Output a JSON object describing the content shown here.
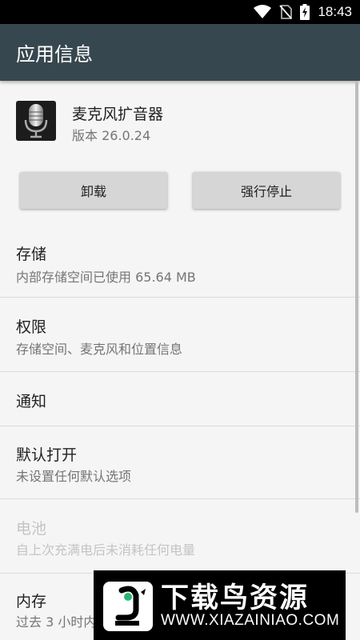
{
  "status_bar": {
    "time": "18:43",
    "icons": [
      "wifi-icon",
      "no-sim-icon",
      "battery-charging-icon"
    ]
  },
  "app_bar": {
    "title": "应用信息"
  },
  "app": {
    "name": "麦克风扩音器",
    "version": "版本 26.0.24",
    "icon": "microphone-icon"
  },
  "buttons": {
    "uninstall": "卸载",
    "force_stop": "强行停止"
  },
  "settings": [
    {
      "title": "存储",
      "subtitle": "内部存储空间已使用 65.64 MB",
      "enabled": true
    },
    {
      "title": "权限",
      "subtitle": "存储空间、麦克风和位置信息",
      "enabled": true
    },
    {
      "title": "通知",
      "subtitle": "",
      "enabled": true
    },
    {
      "title": "默认打开",
      "subtitle": "未设置任何默认选项",
      "enabled": true
    },
    {
      "title": "电池",
      "subtitle": "自上次充满电后未消耗任何电量",
      "enabled": false
    },
    {
      "title": "内存",
      "subtitle": "过去 3 小时内",
      "enabled": true
    }
  ],
  "watermark": {
    "title": "下载鸟资源",
    "url": "WWW.XIAZAINIAO.COM"
  },
  "colors": {
    "app_bar": "#37474f",
    "background": "#f5f5f5",
    "button": "#d6d6d6"
  }
}
